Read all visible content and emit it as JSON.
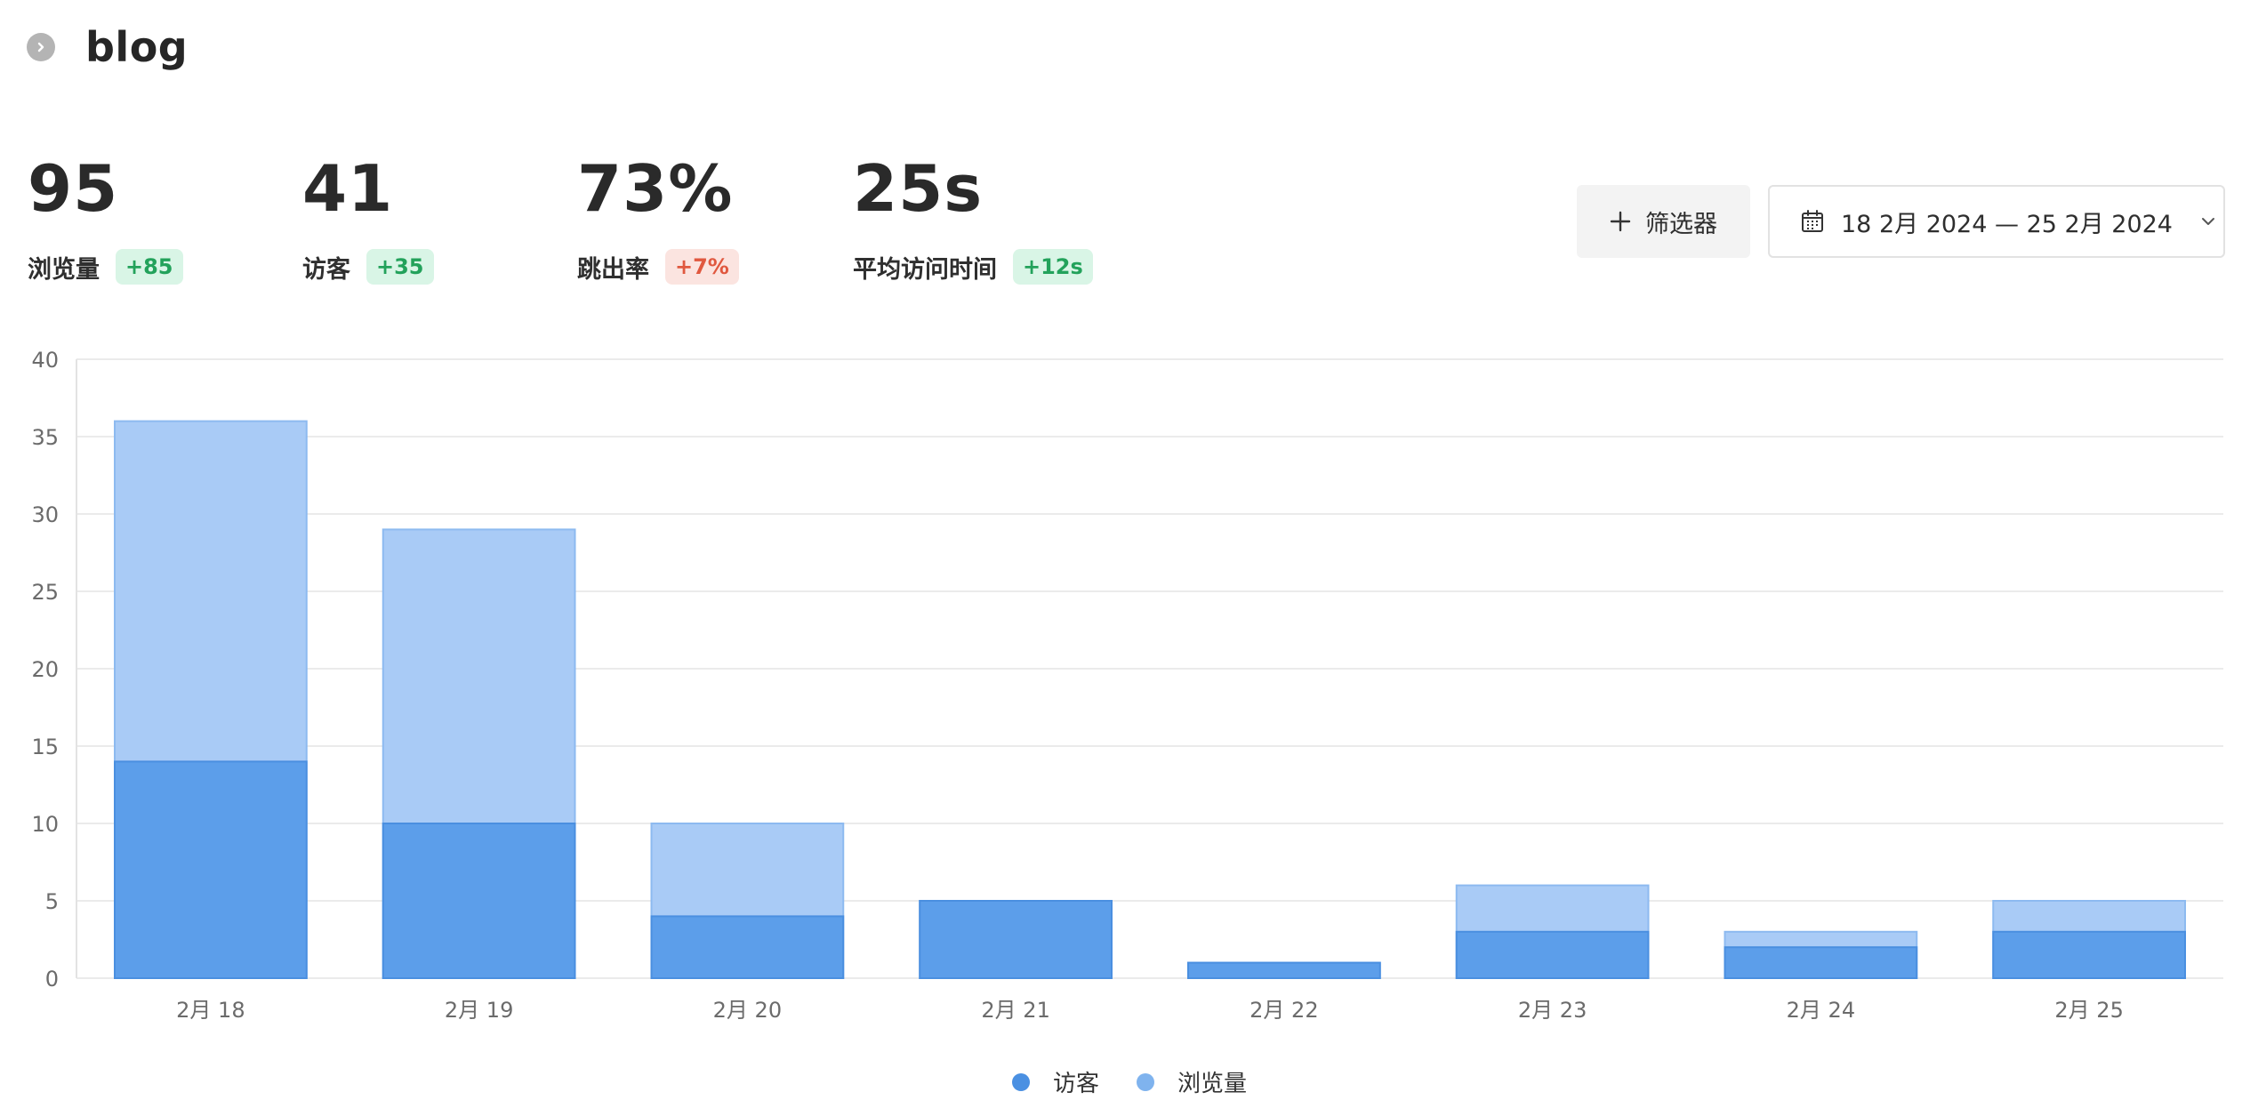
{
  "header": {
    "title": "blog",
    "back_icon": "chevron-right-icon"
  },
  "stats": [
    {
      "value": "95",
      "label": "浏览量",
      "delta": "+85",
      "trend": "up"
    },
    {
      "value": "41",
      "label": "访客",
      "delta": "+35",
      "trend": "up"
    },
    {
      "value": "73%",
      "label": "跳出率",
      "delta": "+7%",
      "trend": "down"
    },
    {
      "value": "25s",
      "label": "平均访问时间",
      "delta": "+12s",
      "trend": "up"
    }
  ],
  "controls": {
    "filter_label": "筛选器",
    "date_range": "18 2月 2024 — 25 2月 2024"
  },
  "colors": {
    "visitors": "#5c9eea",
    "pageviews": "#a9cbf6",
    "badge_up_text": "#23a25b",
    "badge_down_text": "#e0583f"
  },
  "chart_data": {
    "type": "bar",
    "stacked": false,
    "categories": [
      "2月 18",
      "2月 19",
      "2月 20",
      "2月 21",
      "2月 22",
      "2月 23",
      "2月 24",
      "2月 25"
    ],
    "series": [
      {
        "name": "访客",
        "values": [
          14,
          10,
          4,
          5,
          1,
          3,
          2,
          3
        ]
      },
      {
        "name": "浏览量",
        "values": [
          36,
          29,
          10,
          5,
          1,
          6,
          3,
          5
        ]
      }
    ],
    "ylim": [
      0,
      40
    ],
    "yticks": [
      0,
      5,
      10,
      15,
      20,
      25,
      30,
      35,
      40
    ],
    "grid": true,
    "legend_position": "bottom-center"
  }
}
